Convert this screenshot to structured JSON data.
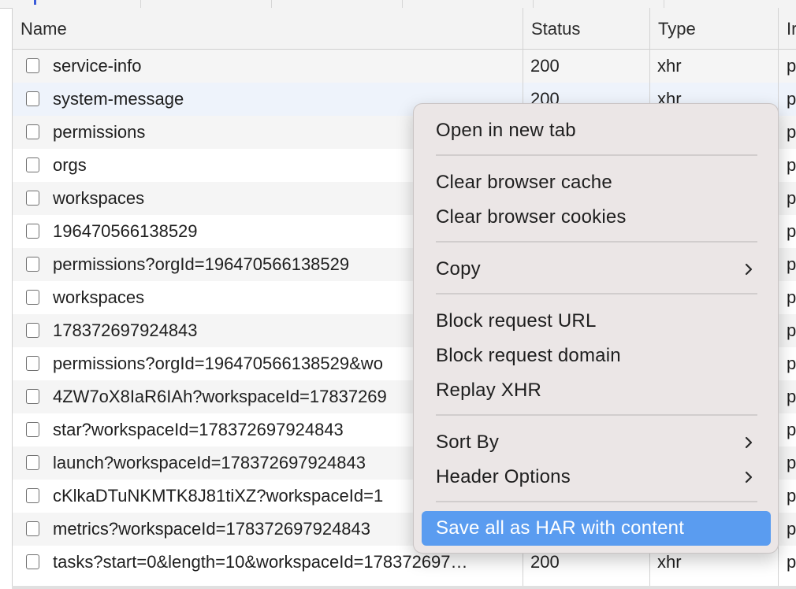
{
  "columns": {
    "name": "Name",
    "status": "Status",
    "type": "Type",
    "initiator": "Ir"
  },
  "rows": [
    {
      "name": "service-info",
      "status": "200",
      "type": "xhr",
      "initiator": "p"
    },
    {
      "name": "system-message",
      "status": "200",
      "type": "xhr",
      "initiator": "p"
    },
    {
      "name": "permissions",
      "status": "",
      "type": "",
      "initiator": "p"
    },
    {
      "name": "orgs",
      "status": "",
      "type": "",
      "initiator": "p"
    },
    {
      "name": "workspaces",
      "status": "",
      "type": "",
      "initiator": "p"
    },
    {
      "name": "196470566138529",
      "status": "",
      "type": "",
      "initiator": "p"
    },
    {
      "name": "permissions?orgId=196470566138529",
      "status": "",
      "type": "",
      "initiator": "p"
    },
    {
      "name": "workspaces",
      "status": "",
      "type": "",
      "initiator": "p"
    },
    {
      "name": "178372697924843",
      "status": "",
      "type": "",
      "initiator": "p"
    },
    {
      "name": "permissions?orgId=196470566138529&wo",
      "status": "",
      "type": "",
      "initiator": "p"
    },
    {
      "name": "4ZW7oX8IaR6IAh?workspaceId=17837269",
      "status": "",
      "type": "",
      "initiator": "p"
    },
    {
      "name": "star?workspaceId=178372697924843",
      "status": "",
      "type": "",
      "initiator": "p"
    },
    {
      "name": "launch?workspaceId=178372697924843",
      "status": "",
      "type": "",
      "initiator": "p"
    },
    {
      "name": "cKlkaDTuNKMTK8J81tiXZ?workspaceId=1",
      "status": "",
      "type": "",
      "initiator": "p"
    },
    {
      "name": "metrics?workspaceId=178372697924843",
      "status": "",
      "type": "",
      "initiator": "p"
    },
    {
      "name": "tasks?start=0&length=10&workspaceId=178372697…",
      "status": "200",
      "type": "xhr",
      "initiator": "p"
    }
  ],
  "context_menu": {
    "open_new_tab": "Open in new tab",
    "clear_cache": "Clear browser cache",
    "clear_cookies": "Clear browser cookies",
    "copy": "Copy",
    "block_url": "Block request URL",
    "block_domain": "Block request domain",
    "replay_xhr": "Replay XHR",
    "sort_by": "Sort By",
    "header_options": "Header Options",
    "save_har": "Save all as HAR with content"
  },
  "icons": {
    "submenu": "chevron-right-icon",
    "row_select": "checkbox"
  },
  "colors": {
    "highlight": "#5a9cf0",
    "menu_bg": "#ebe6e6",
    "header_bg": "#f3f3f3",
    "row_alt": "#f5f5f5",
    "row_hover": "#eef3fb"
  }
}
